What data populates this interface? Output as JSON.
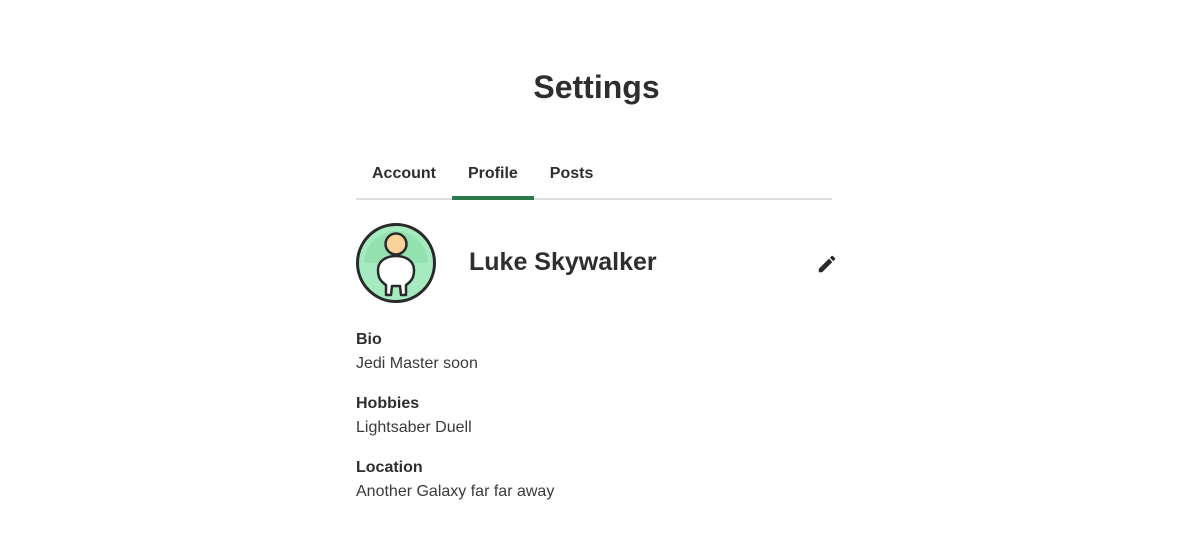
{
  "page": {
    "title": "Settings"
  },
  "tabs": [
    {
      "label": "Account",
      "active": false
    },
    {
      "label": "Profile",
      "active": true
    },
    {
      "label": "Posts",
      "active": false
    }
  ],
  "profile": {
    "name": "Luke Skywalker",
    "avatar_icon": "person-avatar-icon",
    "edit_icon": "pencil-icon"
  },
  "fields": {
    "bio": {
      "label": "Bio",
      "value": "Jedi Master soon"
    },
    "hobbies": {
      "label": "Hobbies",
      "value": "Lightsaber Duell"
    },
    "location": {
      "label": "Location",
      "value": "Another Galaxy far far away"
    }
  },
  "colors": {
    "accent": "#2b7a4b",
    "text": "#2e2e2e",
    "divider": "#dedede",
    "avatar_bg": "#a6ebc0",
    "avatar_skin": "#f7d29a"
  }
}
